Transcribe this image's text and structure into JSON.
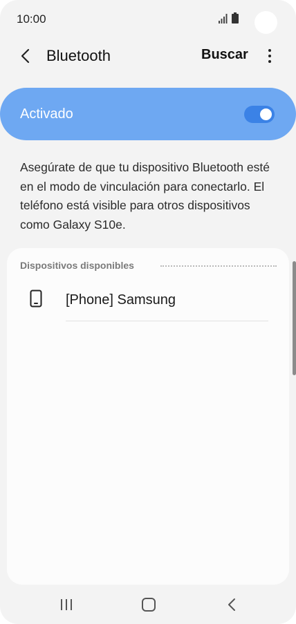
{
  "status_bar": {
    "time": "10:00"
  },
  "header": {
    "title": "Bluetooth",
    "search_label": "Buscar"
  },
  "toggle": {
    "label": "Activado",
    "state": "on"
  },
  "description": "Asegúrate de que tu dispositivo Bluetooth esté en el modo de vinculación para conectarlo. El teléfono está visible para otros dispositivos como Galaxy S10e.",
  "devices": {
    "section_title": "Dispositivos disponibles",
    "items": [
      {
        "name": "[Phone] Samsung",
        "icon": "phone-icon"
      }
    ]
  },
  "icons": {
    "back": "back-arrow-icon",
    "more": "more-vertical-icon",
    "nav_recents": "recent-apps-icon",
    "nav_home": "home-icon",
    "nav_back": "back-icon"
  },
  "colors": {
    "accent": "#6ea8f2",
    "switch": "#3b82e6",
    "background": "#f3f3f3"
  }
}
